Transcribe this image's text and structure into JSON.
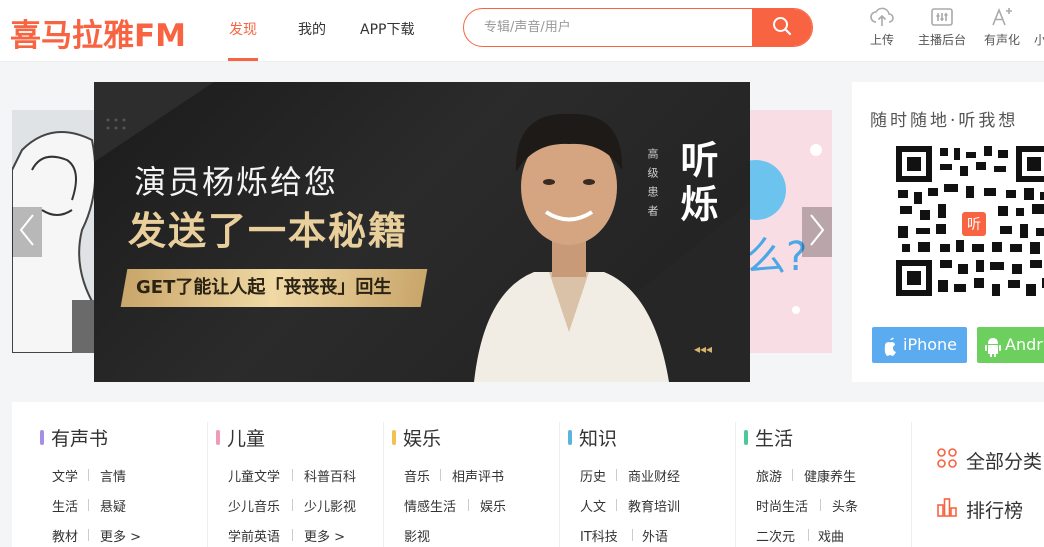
{
  "header": {
    "logo": "喜马拉雅FM",
    "nav": [
      {
        "label": "发现"
      },
      {
        "label": "我的"
      },
      {
        "label": "APP下载"
      }
    ],
    "search_placeholder": "专辑/声音/用户",
    "tools": [
      {
        "label": "上传",
        "icon": "upload-cloud-icon"
      },
      {
        "label": "主播后台",
        "icon": "equalizer-icon"
      },
      {
        "label": "有声化",
        "icon": "text-plus-icon"
      },
      {
        "label": "小",
        "icon": "more-icon"
      }
    ],
    "accent": "#f86442"
  },
  "banner": {
    "line1": "演员杨烁给您",
    "line2": "发送了一本秘籍",
    "line3": "GET了能让人起「丧丧丧」回生",
    "vertical_small": "高级患者",
    "vertical_big": "听烁",
    "deco": "◂◂◂"
  },
  "qr_panel": {
    "title": "随时随地·听我想",
    "qr_center": "听",
    "iphone_label": "iPhone",
    "android_label": "Andr",
    "iphone_color": "#5aabf0",
    "android_color": "#6dcf5d"
  },
  "categories": [
    {
      "title": "有声书",
      "color": "#a58fe6",
      "links": [
        "文学",
        "言情",
        "生活",
        "悬疑",
        "教材",
        "更多 >"
      ]
    },
    {
      "title": "儿童",
      "color": "#f09ab8",
      "links": [
        "儿童文学",
        "科普百科",
        "少儿音乐",
        "少儿影视",
        "学前英语",
        "更多 >"
      ]
    },
    {
      "title": "娱乐",
      "color": "#f2c14e",
      "links": [
        "音乐",
        "相声评书",
        "情感生活",
        "娱乐",
        "影视"
      ]
    },
    {
      "title": "知识",
      "color": "#5ab4e0",
      "links": [
        "历史",
        "商业财经",
        "人文",
        "教育培训",
        "IT科技",
        "外语"
      ]
    },
    {
      "title": "生活",
      "color": "#4cc99a",
      "links": [
        "旅游",
        "健康养生",
        "时尚生活",
        "头条",
        "二次元",
        "戏曲"
      ]
    }
  ],
  "side_links": [
    {
      "label": "全部分类",
      "icon": "grid-icon"
    },
    {
      "label": "排行榜",
      "icon": "ranking-icon"
    }
  ]
}
